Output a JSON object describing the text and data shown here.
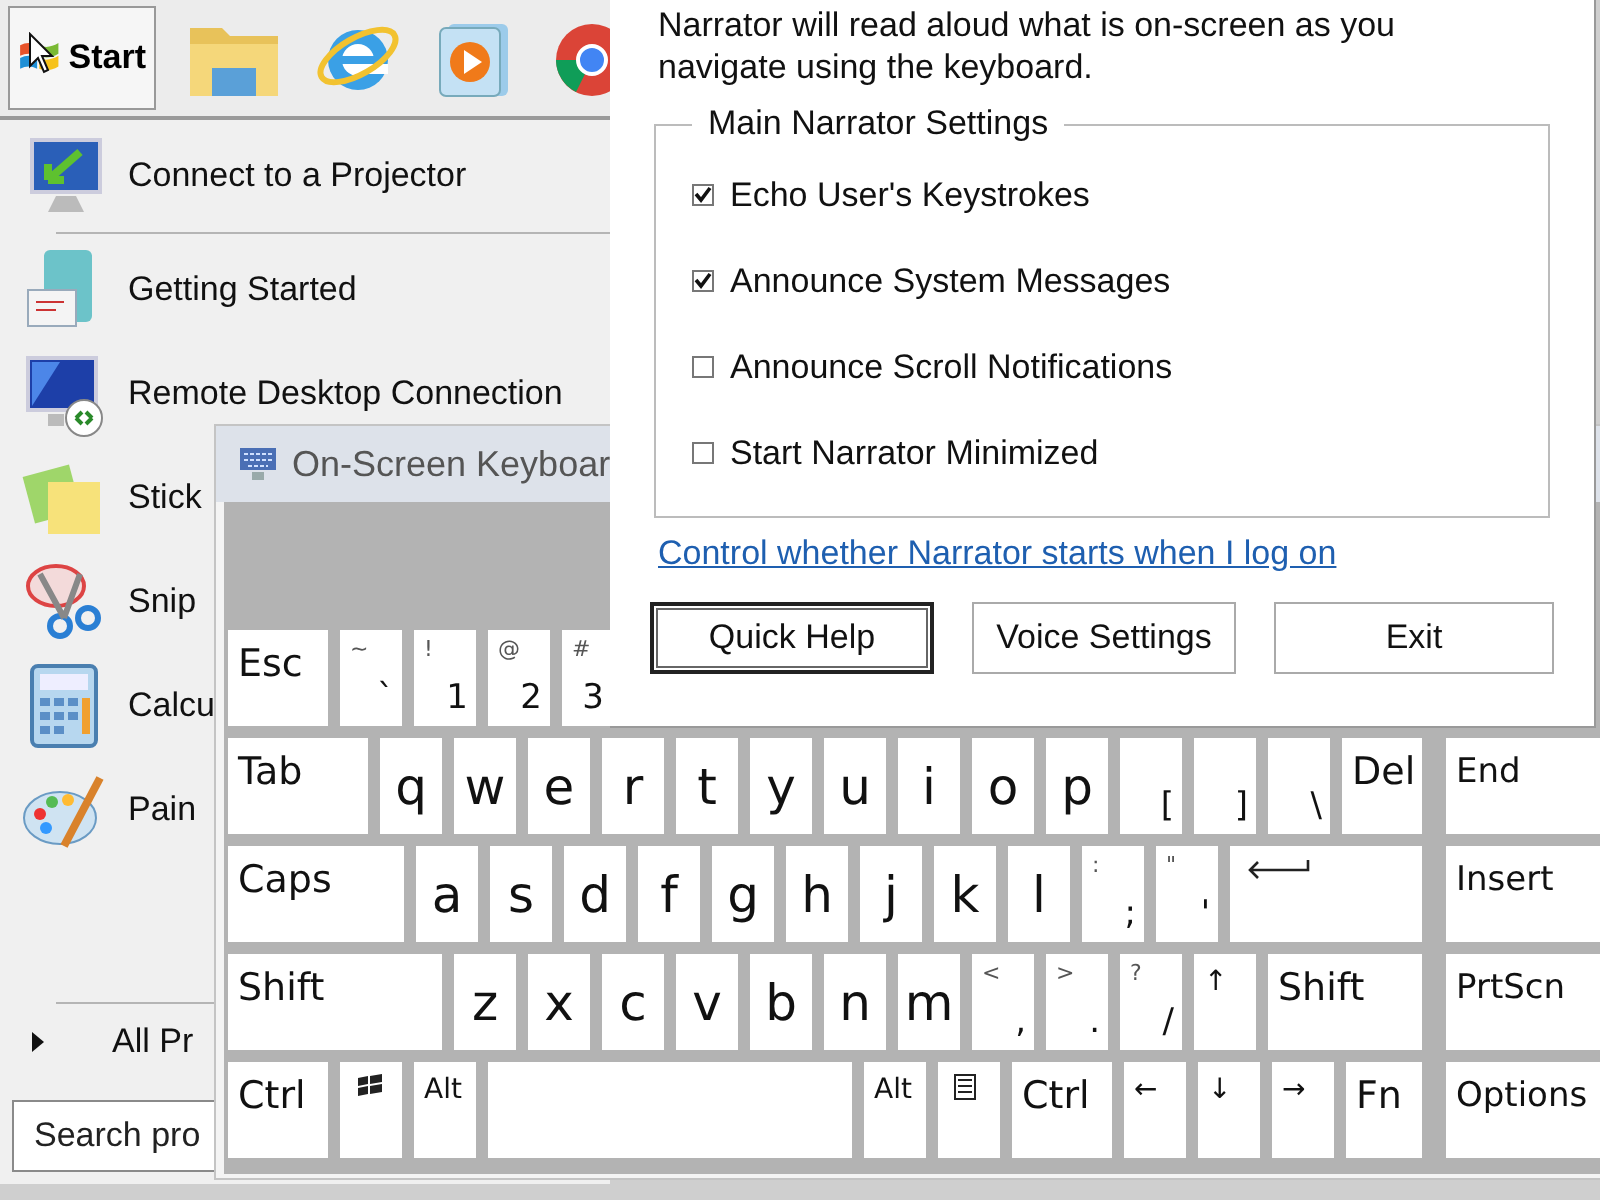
{
  "start_button": {
    "label": "Start"
  },
  "start_menu": {
    "pinned": [
      {
        "label": "Connect to a Projector"
      }
    ],
    "recent": [
      {
        "label": "Getting Started"
      },
      {
        "label": "Remote Desktop Connection"
      },
      {
        "label": "Stick"
      },
      {
        "label": "Snip"
      },
      {
        "label": "Calcu"
      },
      {
        "label": "Pain"
      }
    ],
    "all_programs": "All Pr",
    "search": {
      "placeholder": "Search pro"
    }
  },
  "keyboard": {
    "title": "On-Screen Keyboar",
    "rows": [
      {
        "keys": [
          {
            "kind": "label",
            "label": "Esc"
          },
          {
            "kind": "char",
            "shift": "~",
            "main": "`"
          },
          {
            "kind": "char",
            "shift": "!",
            "main": "1"
          },
          {
            "kind": "char",
            "shift": "@",
            "main": "2"
          },
          {
            "kind": "char",
            "shift": "#",
            "main": "3"
          }
        ]
      },
      {
        "keys": [
          {
            "kind": "label",
            "label": "Tab"
          },
          {
            "kind": "letter",
            "label": "q"
          },
          {
            "kind": "letter",
            "label": "w"
          },
          {
            "kind": "letter",
            "label": "e"
          },
          {
            "kind": "letter",
            "label": "r"
          },
          {
            "kind": "letter",
            "label": "t"
          },
          {
            "kind": "letter",
            "label": "y"
          },
          {
            "kind": "letter",
            "label": "u"
          },
          {
            "kind": "letter",
            "label": "i"
          },
          {
            "kind": "letter",
            "label": "o"
          },
          {
            "kind": "letter",
            "label": "p"
          },
          {
            "kind": "char",
            "main": "["
          },
          {
            "kind": "char",
            "main": "]"
          },
          {
            "kind": "char",
            "main": "\\"
          },
          {
            "kind": "label",
            "label": "Del"
          }
        ]
      },
      {
        "keys": [
          {
            "kind": "label",
            "label": "Caps"
          },
          {
            "kind": "letter",
            "label": "a"
          },
          {
            "kind": "letter",
            "label": "s"
          },
          {
            "kind": "letter",
            "label": "d"
          },
          {
            "kind": "letter",
            "label": "f"
          },
          {
            "kind": "letter",
            "label": "g"
          },
          {
            "kind": "letter",
            "label": "h"
          },
          {
            "kind": "letter",
            "label": "j"
          },
          {
            "kind": "letter",
            "label": "k"
          },
          {
            "kind": "letter",
            "label": "l"
          },
          {
            "kind": "char",
            "shift": ":",
            "main": ";"
          },
          {
            "kind": "char",
            "shift": "\"",
            "main": "'"
          },
          {
            "kind": "enter"
          }
        ]
      },
      {
        "keys": [
          {
            "kind": "label",
            "label": "Shift"
          },
          {
            "kind": "letter",
            "label": "z"
          },
          {
            "kind": "letter",
            "label": "x"
          },
          {
            "kind": "letter",
            "label": "c"
          },
          {
            "kind": "letter",
            "label": "v"
          },
          {
            "kind": "letter",
            "label": "b"
          },
          {
            "kind": "letter",
            "label": "n"
          },
          {
            "kind": "letter",
            "label": "m"
          },
          {
            "kind": "char",
            "shift": "<",
            "main": ","
          },
          {
            "kind": "char",
            "shift": ">",
            "main": "."
          },
          {
            "kind": "char",
            "shift": "?",
            "main": "/"
          },
          {
            "kind": "small",
            "label": "↑"
          },
          {
            "kind": "label",
            "label": "Shift"
          }
        ]
      },
      {
        "keys": [
          {
            "kind": "label",
            "label": "Ctrl"
          },
          {
            "kind": "logo"
          },
          {
            "kind": "small",
            "label": "Alt"
          },
          {
            "kind": "space"
          },
          {
            "kind": "small",
            "label": "Alt"
          },
          {
            "kind": "menu"
          },
          {
            "kind": "label",
            "label": "Ctrl"
          },
          {
            "kind": "small",
            "label": "←"
          },
          {
            "kind": "small",
            "label": "↓"
          },
          {
            "kind": "small",
            "label": "→"
          },
          {
            "kind": "label",
            "label": "Fn"
          }
        ]
      }
    ],
    "side_keys": [
      {
        "label": "End"
      },
      {
        "label": "Insert"
      },
      {
        "label": "PrtScn"
      },
      {
        "label": "Options"
      }
    ]
  },
  "narrator": {
    "intro": "Narrator will read aloud what is on-screen as you navigate using the keyboard.",
    "group_title": "Main Narrator Settings",
    "settings": [
      {
        "label": "Echo User's Keystrokes",
        "checked": true
      },
      {
        "label": "Announce System Messages",
        "checked": true
      },
      {
        "label": "Announce Scroll Notifications",
        "checked": false
      },
      {
        "label": "Start Narrator Minimized",
        "checked": false
      }
    ],
    "link": "Control whether Narrator starts when I log on",
    "buttons": [
      {
        "label": "Quick Help",
        "default": true
      },
      {
        "label": "Voice Settings",
        "default": false
      },
      {
        "label": "Exit",
        "default": false
      }
    ]
  }
}
